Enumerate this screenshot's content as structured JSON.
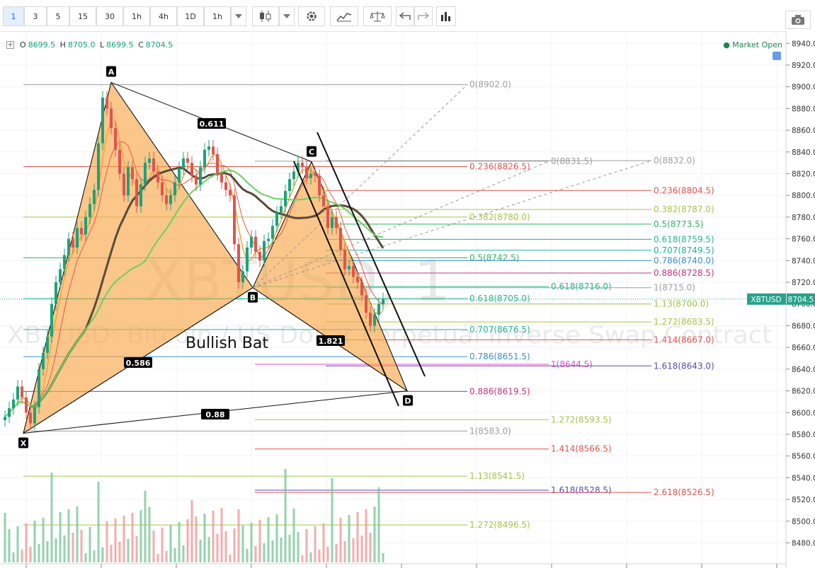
{
  "toolbar": {
    "intervals": [
      "1",
      "3",
      "5",
      "15",
      "30",
      "1h",
      "4h",
      "1D",
      "1h"
    ],
    "active_interval": "1"
  },
  "legend": {
    "O_label": "O",
    "O": "8699.5",
    "H_label": "H",
    "H": "8705.0",
    "L_label": "L",
    "L": "8699.5",
    "C_label": "C",
    "C": "8704.5",
    "market_status": "Market Open"
  },
  "watermark": {
    "symbol": "XBTUSD, 1",
    "description": "XBTUSD: Bitcoin / US Dollar Perpetual Inverse Swap Contract"
  },
  "colors": {
    "accent": "#2962ff",
    "harmonic_fill": "#f7a84a",
    "ma_green": "#6ad35f",
    "ma_dark": "#5a4a3a",
    "ma_orange": "#f4a43a",
    "ma_red": "#e85a4a",
    "up": "#1aa37a",
    "down": "#e0544f",
    "volume_up": "#7cc79a",
    "volume_down": "#ef9a97",
    "market_open": "#1a8754"
  },
  "chart_data": {
    "type": "candlestick",
    "symbol": "XBTUSD",
    "pattern_name": "Bullish Bat",
    "last_price_label": "XBTUSD",
    "last_price": "8704.5",
    "ylim": [
      8466,
      8948
    ],
    "y_ticks": [
      "8940.0",
      "8920.0",
      "8900.0",
      "8880.0",
      "8860.0",
      "8840.0",
      "8820.0",
      "8800.0",
      "8780.0",
      "8760.0",
      "8740.0",
      "8720.0",
      "8700.0",
      "8680.0",
      "8660.0",
      "8640.0",
      "8620.0",
      "8600.0",
      "8580.0",
      "8560.0",
      "8540.0",
      "8520.0",
      "8500.0",
      "8480.0"
    ],
    "harmonic_points": [
      {
        "label": "X",
        "price": 8581
      },
      {
        "label": "A",
        "price": 8904
      },
      {
        "label": "B",
        "price": 8715
      },
      {
        "label": "C",
        "price": 8831
      },
      {
        "label": "D",
        "price": 8620
      }
    ],
    "harmonic_ratios": [
      "0.611",
      "0.586",
      "1.821",
      "0.88"
    ],
    "fib_levels": [
      {
        "label": "0(8902.0)",
        "price": 8902.0,
        "color": "#9e9e9e"
      },
      {
        "label": "0.236(8826.5)",
        "price": 8826.5,
        "color": "#e0544f"
      },
      {
        "label": "0.382(8780.0)",
        "price": 8780.0,
        "color": "#a5c64a"
      },
      {
        "label": "0.5(8742.5)",
        "price": 8742.5,
        "color": "#2db56a"
      },
      {
        "label": "0.618(8705.0)",
        "price": 8705.0,
        "color": "#27b88a"
      },
      {
        "label": "0.707(8676.5)",
        "price": 8676.5,
        "color": "#20b3a0"
      },
      {
        "label": "0.786(8651.5)",
        "price": 8651.5,
        "color": "#3a8fd0"
      },
      {
        "label": "0.886(8619.5)",
        "price": 8619.5,
        "color": "#c0357f"
      },
      {
        "label": "1(8583.0)",
        "price": 8583.0,
        "color": "#9e9e9e"
      },
      {
        "label": "1.13(8541.5)",
        "price": 8541.5,
        "color": "#a5c64a"
      },
      {
        "label": "1.272(8496.5)",
        "price": 8496.5,
        "color": "#a5c64a"
      },
      {
        "label": "0(8831.5)",
        "price": 8831.5,
        "color": "#9e9e9e"
      },
      {
        "label": "0.618(8716.0)",
        "price": 8716.0,
        "color": "#27b88a"
      },
      {
        "label": "1(8644.5)",
        "price": 8644.5,
        "color": "#e64ad0"
      },
      {
        "label": "1.272(8593.5)",
        "price": 8593.5,
        "color": "#a5c64a"
      },
      {
        "label": "1.414(8566.5)",
        "price": 8566.5,
        "color": "#e0544f"
      },
      {
        "label": "1.618(8528.5)",
        "price": 8528.5,
        "color": "#5a4ab0"
      },
      {
        "label": "0(8832.0)",
        "price": 8832.0,
        "color": "#9e9e9e"
      },
      {
        "label": "0.236(8804.5)",
        "price": 8804.5,
        "color": "#e0544f"
      },
      {
        "label": "0.382(8787.0)",
        "price": 8787.0,
        "color": "#a5c64a"
      },
      {
        "label": "0.5(8773.5)",
        "price": 8773.5,
        "color": "#2db56a"
      },
      {
        "label": "0.618(8759.5)",
        "price": 8759.5,
        "color": "#27b88a"
      },
      {
        "label": "0.707(8749.5)",
        "price": 8749.5,
        "color": "#20b3a0"
      },
      {
        "label": "0.786(8740.0)",
        "price": 8740.0,
        "color": "#3a8fd0"
      },
      {
        "label": "0.886(8728.5)",
        "price": 8728.5,
        "color": "#c0357f"
      },
      {
        "label": "1(8715.0)",
        "price": 8715.0,
        "color": "#9e9e9e"
      },
      {
        "label": "1.13(8700.0)",
        "price": 8700.0,
        "color": "#a5c64a"
      },
      {
        "label": "1.272(8683.5)",
        "price": 8683.5,
        "color": "#a5c64a"
      },
      {
        "label": "1.414(8667.0)",
        "price": 8667.0,
        "color": "#e0544f"
      },
      {
        "label": "1.618(8643.0)",
        "price": 8643.0,
        "color": "#5a4ab0"
      },
      {
        "label": "2.618(8526.5)",
        "price": 8526.5,
        "color": "#e0544f"
      }
    ],
    "candle_closes": [
      8596,
      8604,
      8612,
      8624,
      8614,
      8600,
      8590,
      8605,
      8640,
      8655,
      8670,
      8700,
      8720,
      8732,
      8745,
      8760,
      8752,
      8770,
      8764,
      8780,
      8792,
      8805,
      8848,
      8890,
      8880,
      8862,
      8842,
      8820,
      8800,
      8826,
      8815,
      8790,
      8810,
      8830,
      8834,
      8822,
      8812,
      8800,
      8792,
      8800,
      8812,
      8825,
      8834,
      8830,
      8818,
      8810,
      8826,
      8842,
      8845,
      8838,
      8820,
      8812,
      8805,
      8800,
      8755,
      8720,
      8730,
      8752,
      8762,
      8748,
      8740,
      8758,
      8760,
      8772,
      8784,
      8790,
      8804,
      8815,
      8822,
      8830,
      8826,
      8816,
      8820,
      8818,
      8800,
      8790,
      8770,
      8780,
      8770,
      8750,
      8732,
      8735,
      8725,
      8720,
      8708,
      8692,
      8680,
      8690,
      8700,
      8704.5
    ]
  }
}
